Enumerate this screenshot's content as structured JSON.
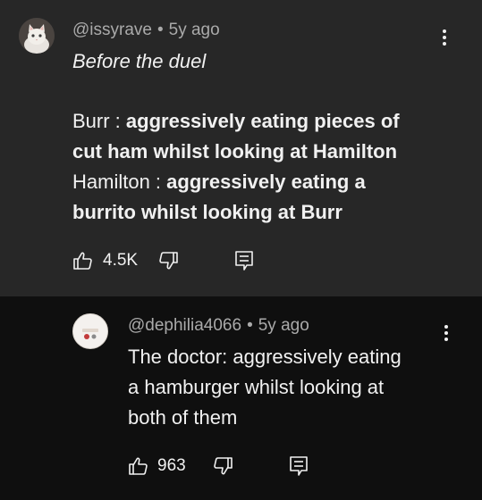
{
  "comments": [
    {
      "author": "@issyrave",
      "age": "5y ago",
      "lines": [
        {
          "parts": [
            {
              "text": "Before the duel",
              "style": "italic"
            }
          ]
        },
        {
          "parts": []
        },
        {
          "parts": [
            {
              "text": "Burr : ",
              "style": "normal"
            },
            {
              "text": "aggressively eating pieces of",
              "style": "bold"
            }
          ]
        },
        {
          "parts": [
            {
              "text": "cut ham whilst looking at Hamilton",
              "style": "bold"
            }
          ]
        },
        {
          "parts": [
            {
              "text": "Hamilton : ",
              "style": "normal"
            },
            {
              "text": "aggressively eating a",
              "style": "bold"
            }
          ]
        },
        {
          "parts": [
            {
              "text": "burrito whilst looking at Burr",
              "style": "bold"
            }
          ]
        }
      ],
      "likes": "4.5K"
    },
    {
      "author": "@dephilia4066",
      "age": "5y ago",
      "lines": [
        {
          "parts": [
            {
              "text": "The doctor: aggressively eating",
              "style": "normal"
            }
          ]
        },
        {
          "parts": [
            {
              "text": "a hamburger whilst looking at",
              "style": "normal"
            }
          ]
        },
        {
          "parts": [
            {
              "text": "both of them",
              "style": "normal"
            }
          ]
        }
      ],
      "likes": "963"
    }
  ],
  "icons": {
    "like": "thumbs-up-icon",
    "dislike": "thumbs-down-icon",
    "reply": "reply-icon",
    "more": "more-vertical-icon"
  }
}
